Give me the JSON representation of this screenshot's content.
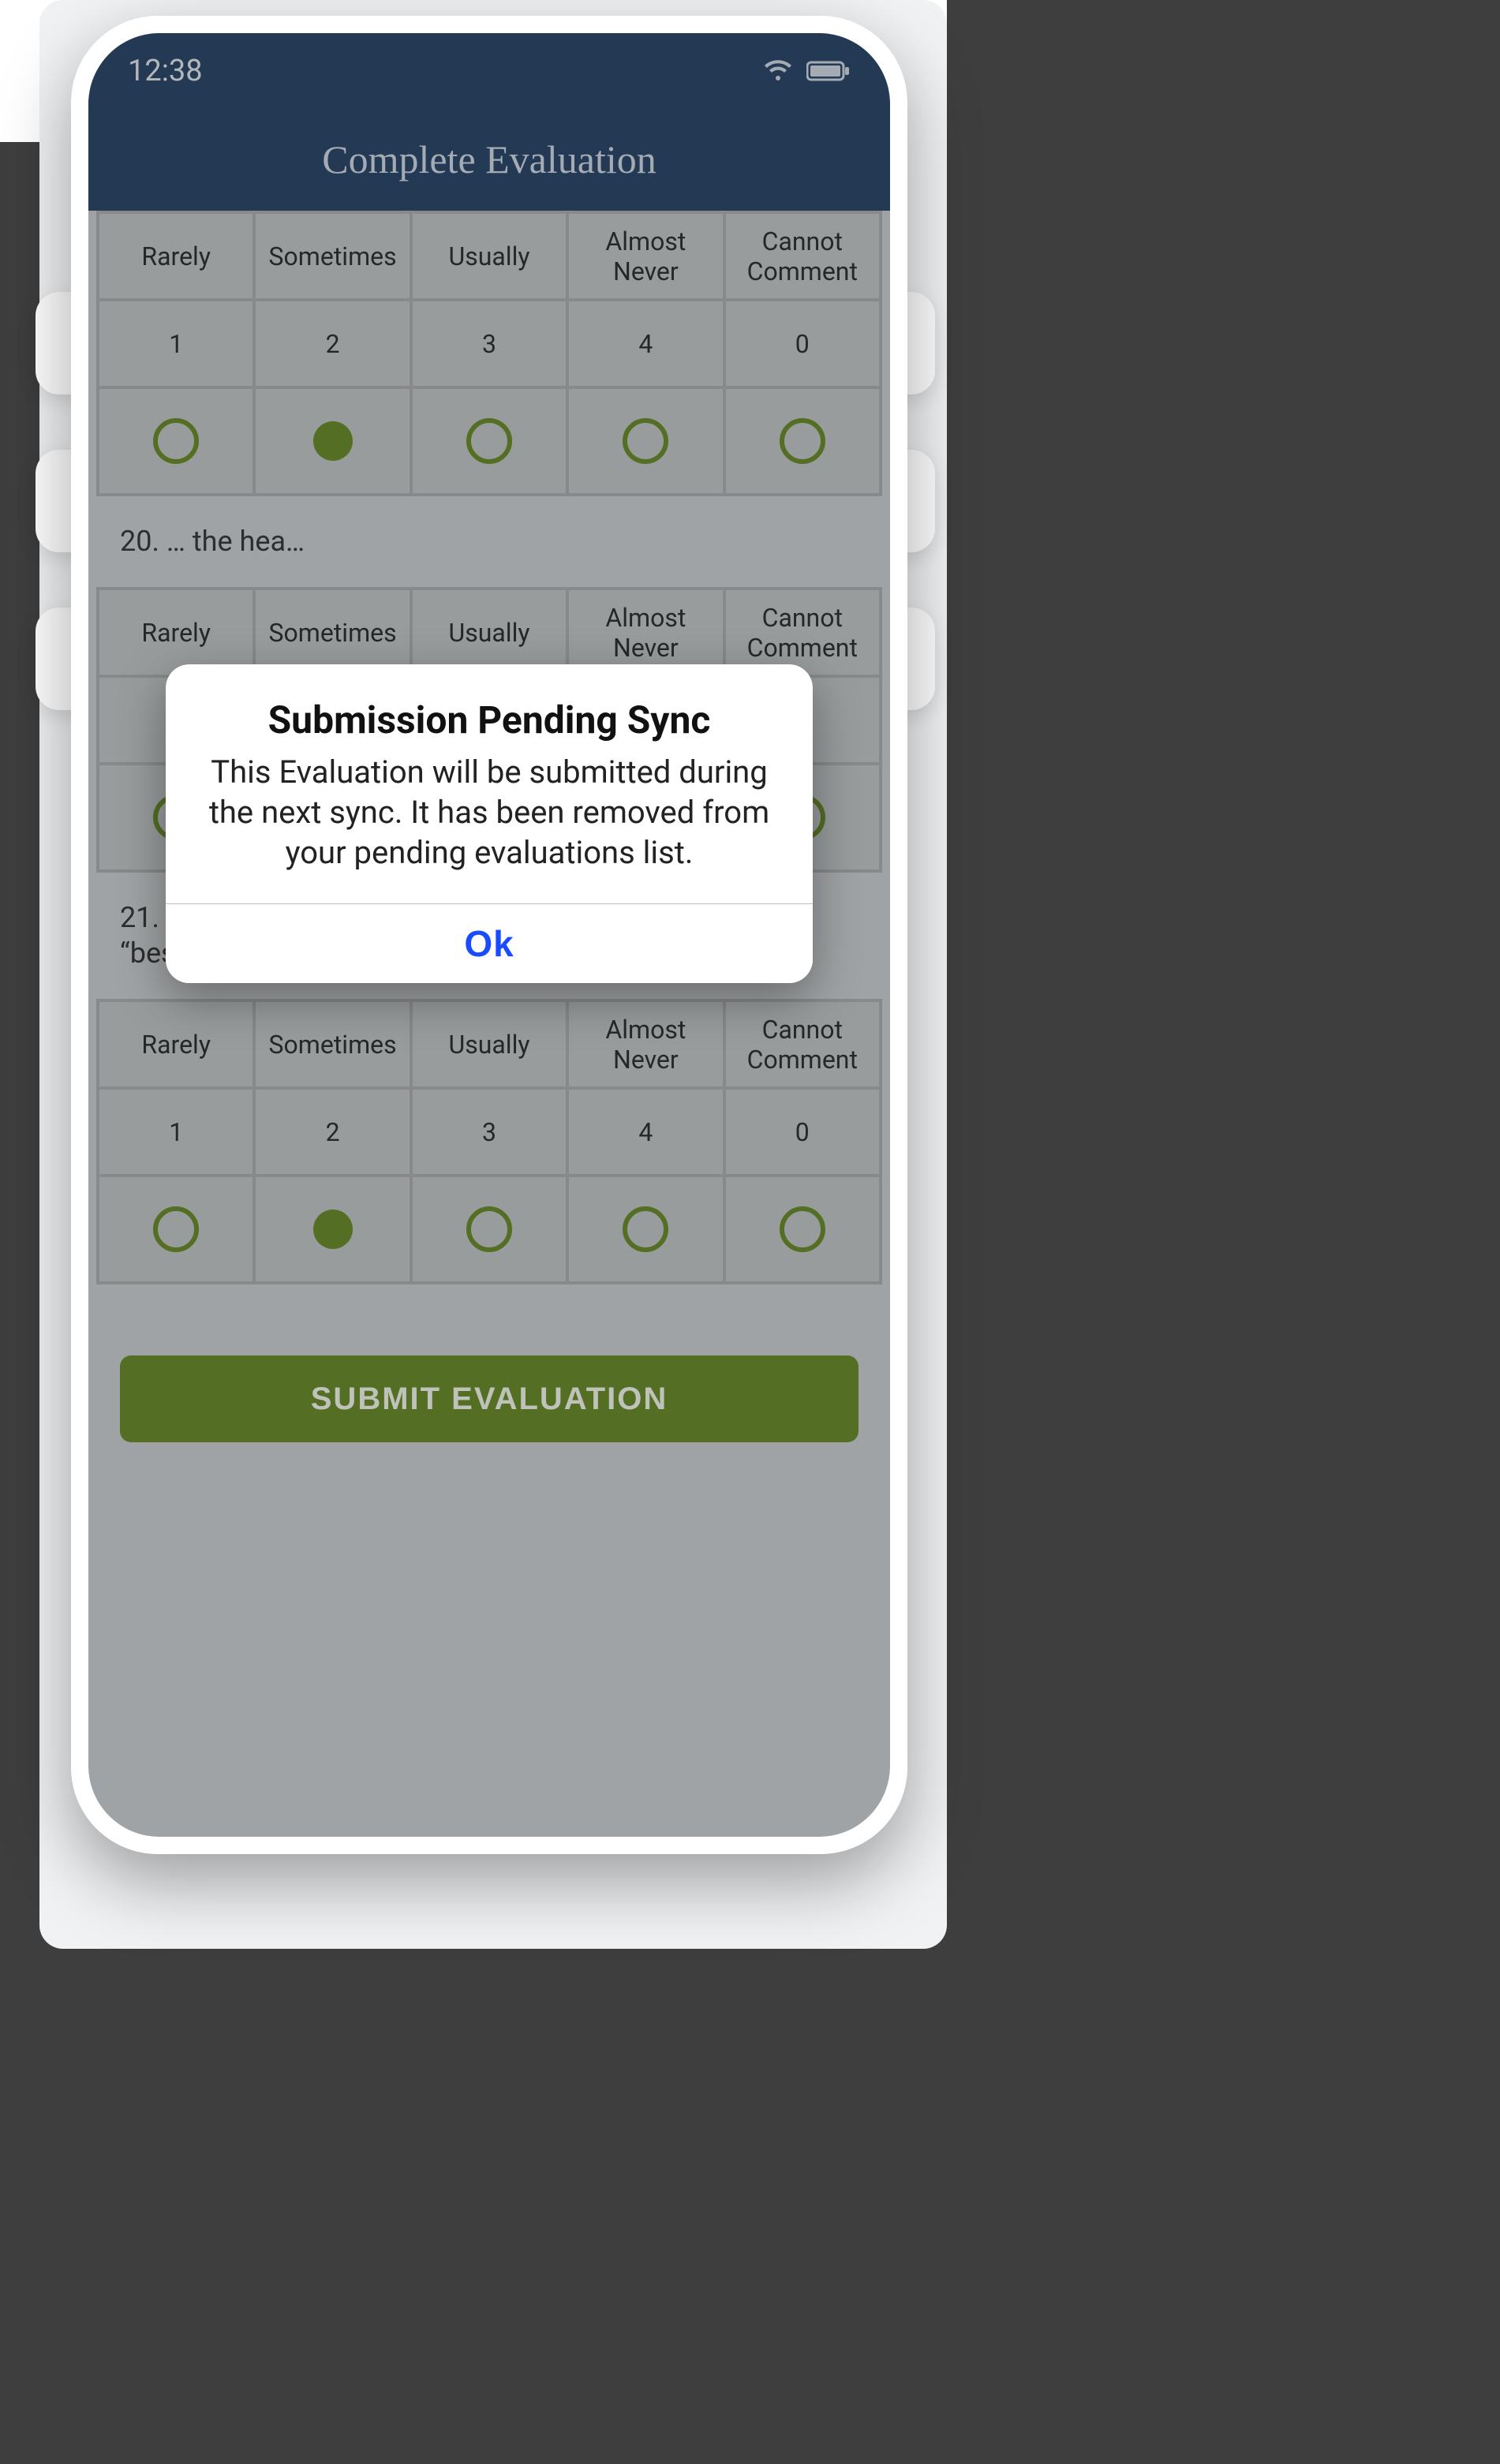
{
  "statusbar": {
    "time": "12:38"
  },
  "header": {
    "title": "Complete Evaluation"
  },
  "option_columns": [
    {
      "label": "Rarely",
      "value": "1"
    },
    {
      "label": "Sometimes",
      "value": "2"
    },
    {
      "label": "Usually",
      "value": "3"
    },
    {
      "label": "Almost Never",
      "value": "4"
    },
    {
      "label": "Cannot Comment",
      "value": "0"
    }
  ],
  "questions": [
    {
      "id": 19,
      "text": "",
      "selected_index": 1
    },
    {
      "id": 20,
      "text": "20. … the hea…",
      "selected_index": null
    },
    {
      "id": 21,
      "text": "21. Choose a reason why the answer to the previous “best”*",
      "selected_index": 1
    }
  ],
  "submit_label": "SUBMIT EVALUATION",
  "dialog": {
    "title": "Submission Pending Sync",
    "body": "This Evaluation will be submitted during the next sync. It has been removed from your pending evaluations list.",
    "ok": "Ok"
  }
}
